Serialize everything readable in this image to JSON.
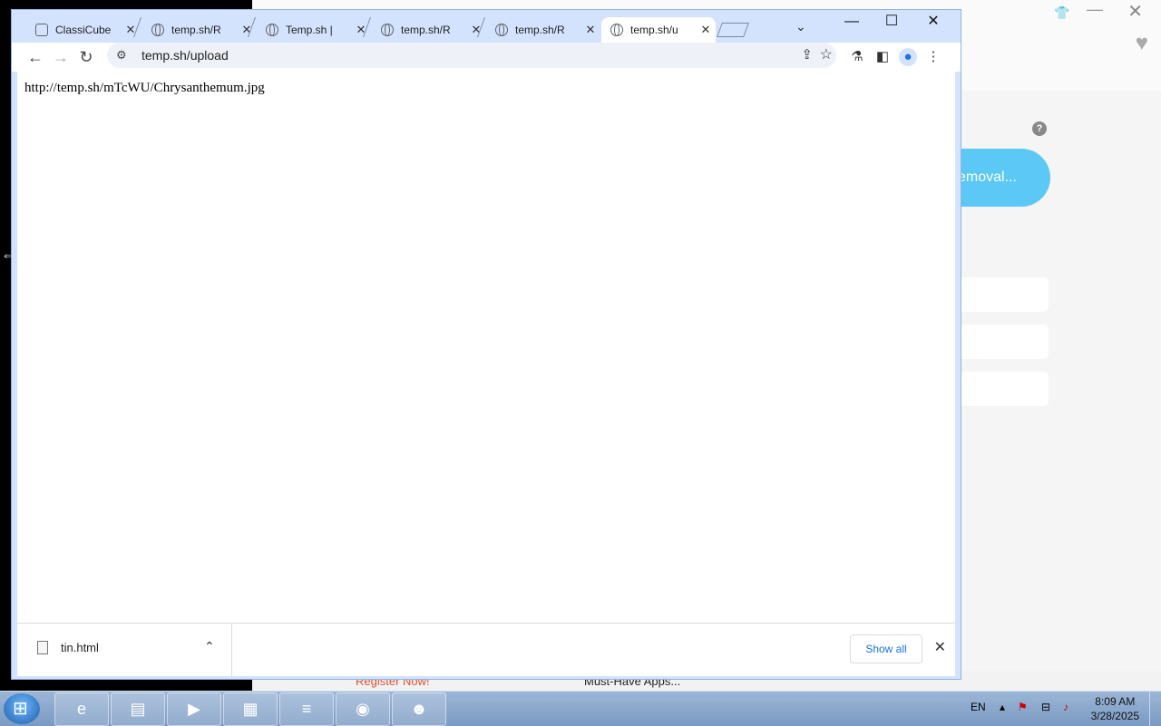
{
  "background_app": {
    "pill_text": "emoval...",
    "help_icon": "question-icon",
    "bottom_left": "Register Now!",
    "bottom_right": "Must-Have Apps..."
  },
  "browser": {
    "tabs": [
      {
        "label": "ClassiCube",
        "icon": "cube-icon"
      },
      {
        "label": "temp.sh/R",
        "icon": "globe-icon"
      },
      {
        "label": "Temp.sh |",
        "icon": "globe-icon"
      },
      {
        "label": "temp.sh/R",
        "icon": "globe-icon"
      },
      {
        "label": "temp.sh/R",
        "icon": "globe-icon"
      },
      {
        "label": "temp.sh/u",
        "icon": "globe-icon",
        "active": true
      }
    ],
    "url": "temp.sh/upload",
    "page_text": "http://temp.sh/mTcWU/Chrysanthemum.jpg",
    "download": {
      "filename": "tin.html",
      "show_all_label": "Show all"
    }
  },
  "taskbar": {
    "language": "EN",
    "time": "8:09 AM",
    "date": "3/28/2025",
    "apps": [
      "internet-explorer-icon",
      "file-explorer-icon",
      "media-player-icon",
      "control-panel-icon",
      "database-icon",
      "chrome-icon",
      "user-shield-icon"
    ]
  }
}
